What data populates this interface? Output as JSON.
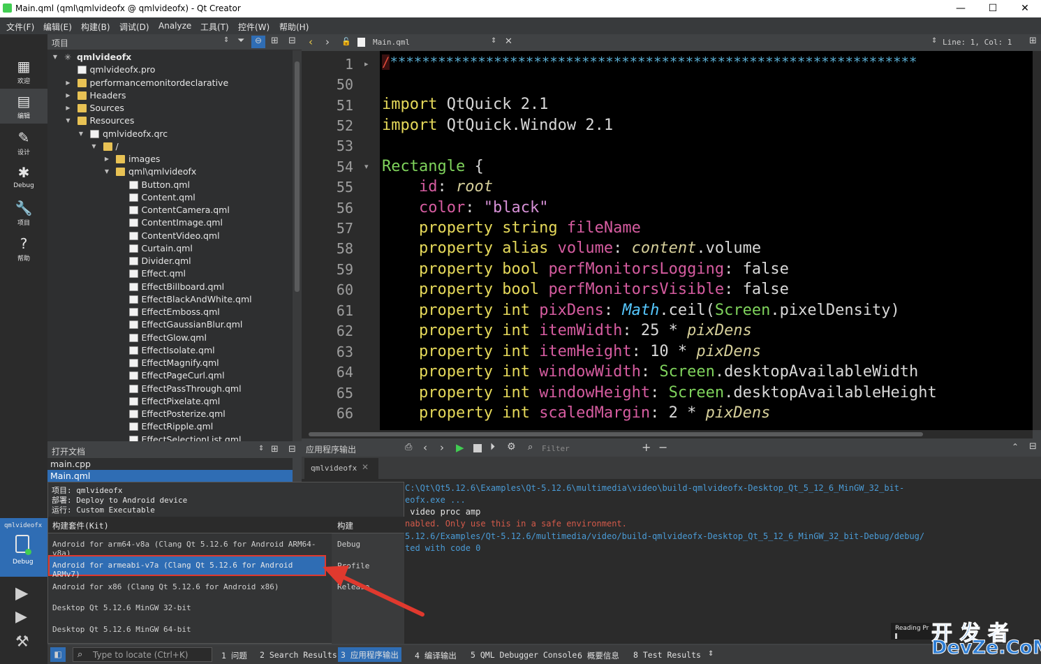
{
  "window": {
    "title": "Main.qml (qml\\qmlvideofx @ qmlvideofx) - Qt Creator",
    "minimize": "—",
    "maximize": "☐",
    "close": "✕"
  },
  "menu": [
    "文件(F)",
    "编辑(E)",
    "构建(B)",
    "调试(D)",
    "Analyze",
    "工具(T)",
    "控件(W)",
    "帮助(H)"
  ],
  "modes": [
    {
      "label": "欢迎",
      "icon": "grid-icon"
    },
    {
      "label": "编辑",
      "icon": "edit-icon"
    },
    {
      "label": "设计",
      "icon": "pen-icon"
    },
    {
      "label": "Debug",
      "icon": "bug-icon"
    },
    {
      "label": "项目",
      "icon": "wrench-icon"
    },
    {
      "label": "帮助",
      "icon": "help-icon"
    }
  ],
  "kit_mode": {
    "project": "qmlvideofx",
    "label": "Debug"
  },
  "project_panel": {
    "title": "项目"
  },
  "tree": [
    {
      "label": "qmlvideofx",
      "depth": 0,
      "arrow": "▼",
      "icon": "project"
    },
    {
      "label": "qmlvideofx.pro",
      "depth": 1,
      "arrow": "",
      "icon": "file"
    },
    {
      "label": "performancemonitordeclarative",
      "depth": 1,
      "arrow": "▶",
      "icon": "folder"
    },
    {
      "label": "Headers",
      "depth": 1,
      "arrow": "▶",
      "icon": "folder"
    },
    {
      "label": "Sources",
      "depth": 1,
      "arrow": "▶",
      "icon": "folder"
    },
    {
      "label": "Resources",
      "depth": 1,
      "arrow": "▼",
      "icon": "folder"
    },
    {
      "label": "qmlvideofx.qrc",
      "depth": 2,
      "arrow": "▼",
      "icon": "file"
    },
    {
      "label": "/",
      "depth": 3,
      "arrow": "▼",
      "icon": "folder"
    },
    {
      "label": "images",
      "depth": 4,
      "arrow": "▶",
      "icon": "folder"
    },
    {
      "label": "qml\\qmlvideofx",
      "depth": 4,
      "arrow": "▼",
      "icon": "folder"
    },
    {
      "label": "Button.qml",
      "depth": 5,
      "arrow": "",
      "icon": "qml"
    },
    {
      "label": "Content.qml",
      "depth": 5,
      "arrow": "",
      "icon": "qml"
    },
    {
      "label": "ContentCamera.qml",
      "depth": 5,
      "arrow": "",
      "icon": "qml"
    },
    {
      "label": "ContentImage.qml",
      "depth": 5,
      "arrow": "",
      "icon": "qml"
    },
    {
      "label": "ContentVideo.qml",
      "depth": 5,
      "arrow": "",
      "icon": "qml"
    },
    {
      "label": "Curtain.qml",
      "depth": 5,
      "arrow": "",
      "icon": "qml"
    },
    {
      "label": "Divider.qml",
      "depth": 5,
      "arrow": "",
      "icon": "qml"
    },
    {
      "label": "Effect.qml",
      "depth": 5,
      "arrow": "",
      "icon": "qml"
    },
    {
      "label": "EffectBillboard.qml",
      "depth": 5,
      "arrow": "",
      "icon": "qml"
    },
    {
      "label": "EffectBlackAndWhite.qml",
      "depth": 5,
      "arrow": "",
      "icon": "qml"
    },
    {
      "label": "EffectEmboss.qml",
      "depth": 5,
      "arrow": "",
      "icon": "qml"
    },
    {
      "label": "EffectGaussianBlur.qml",
      "depth": 5,
      "arrow": "",
      "icon": "qml"
    },
    {
      "label": "EffectGlow.qml",
      "depth": 5,
      "arrow": "",
      "icon": "qml"
    },
    {
      "label": "EffectIsolate.qml",
      "depth": 5,
      "arrow": "",
      "icon": "qml"
    },
    {
      "label": "EffectMagnify.qml",
      "depth": 5,
      "arrow": "",
      "icon": "qml"
    },
    {
      "label": "EffectPageCurl.qml",
      "depth": 5,
      "arrow": "",
      "icon": "qml"
    },
    {
      "label": "EffectPassThrough.qml",
      "depth": 5,
      "arrow": "",
      "icon": "qml"
    },
    {
      "label": "EffectPixelate.qml",
      "depth": 5,
      "arrow": "",
      "icon": "qml"
    },
    {
      "label": "EffectPosterize.qml",
      "depth": 5,
      "arrow": "",
      "icon": "qml"
    },
    {
      "label": "EffectRipple.qml",
      "depth": 5,
      "arrow": "",
      "icon": "qml"
    },
    {
      "label": "EffectSelectionList.qml",
      "depth": 5,
      "arrow": "",
      "icon": "qml"
    }
  ],
  "open_docs": {
    "title": "打开文档",
    "items": [
      "main.cpp",
      "Main.qml"
    ],
    "selected": 1
  },
  "editor": {
    "file": "Main.qml",
    "position": "Line: 1, Col: 1"
  },
  "code_lines": [
    {
      "n": "1",
      "fold": "▸"
    },
    {
      "n": "50",
      "fold": ""
    },
    {
      "n": "51",
      "fold": ""
    },
    {
      "n": "52",
      "fold": ""
    },
    {
      "n": "53",
      "fold": ""
    },
    {
      "n": "54",
      "fold": "▾"
    },
    {
      "n": "55",
      "fold": ""
    },
    {
      "n": "56",
      "fold": ""
    },
    {
      "n": "57",
      "fold": ""
    },
    {
      "n": "58",
      "fold": ""
    },
    {
      "n": "59",
      "fold": ""
    },
    {
      "n": "60",
      "fold": ""
    },
    {
      "n": "61",
      "fold": ""
    },
    {
      "n": "62",
      "fold": ""
    },
    {
      "n": "63",
      "fold": ""
    },
    {
      "n": "64",
      "fold": ""
    },
    {
      "n": "65",
      "fold": ""
    },
    {
      "n": "66",
      "fold": ""
    }
  ],
  "code": {
    "l1_slash": "/",
    "l1_stars": "******************************************************************",
    "l51_kw": "import",
    "l51_rest": " QtQuick 2.1",
    "l52_kw": "import",
    "l52_rest": " QtQuick.Window 2.1",
    "l54_kw": "Rectangle",
    "l54_rest": " {",
    "l55_a": "    id",
    "l55_b": ": ",
    "l55_c": "root",
    "l56_a": "    color",
    "l56_b": ": ",
    "l56_c": "\"black\"",
    "l57_a": "    property",
    "l57_b": " string ",
    "l57_c": "fileName",
    "l58_a": "    property",
    "l58_b": " alias ",
    "l58_c": "volume",
    "l58_d": ": ",
    "l58_e": "content",
    "l58_f": ".volume",
    "l59_a": "    property",
    "l59_b": " bool ",
    "l59_c": "perfMonitorsLogging",
    "l59_d": ": false",
    "l60_a": "    property",
    "l60_b": " bool ",
    "l60_c": "perfMonitorsVisible",
    "l60_d": ": false",
    "l61_a": "    property",
    "l61_b": " int ",
    "l61_c": "pixDens",
    "l61_d": ": ",
    "l61_e": "Math",
    "l61_f": ".ceil(",
    "l61_g": "Screen",
    "l61_h": ".pixelDensity)",
    "l62_a": "    property",
    "l62_b": " int ",
    "l62_c": "itemWidth",
    "l62_d": ": 25 * ",
    "l62_e": "pixDens",
    "l63_a": "    property",
    "l63_b": " int ",
    "l63_c": "itemHeight",
    "l63_d": ": 10 * ",
    "l63_e": "pixDens",
    "l64_a": "    property",
    "l64_b": " int ",
    "l64_c": "windowWidth",
    "l64_d": ": ",
    "l64_e": "Screen",
    "l64_f": ".desktopAvailableWidth",
    "l65_a": "    property",
    "l65_b": " int ",
    "l65_c": "windowHeight",
    "l65_d": ": ",
    "l65_e": "Screen",
    "l65_f": ".desktopAvailableHeight",
    "l66_a": "    property",
    "l66_b": " int ",
    "l66_c": "scaledMargin",
    "l66_d": ": 2 * ",
    "l66_e": "pixDens"
  },
  "output": {
    "title": "应用程序输出",
    "filter_placeholder": "Filter",
    "tab": "qmlvideofx",
    "lines": [
      {
        "text": "C:\\Qt\\Qt5.12.6\\Examples\\Qt-5.12.6\\multimedia\\video\\build-qmlvideofx-Desktop_Qt_5_12_6_MinGW_32_bit-",
        "color": "#4a9bd6"
      },
      {
        "text": "eofx.exe ...",
        "color": "#4a9bd6"
      },
      {
        "text": " video proc amp",
        "color": "#e6e6e6"
      },
      {
        "text": "nabled. Only use this in a safe environment.",
        "color": "#d45a4a"
      },
      {
        "text": "5.12.6/Examples/Qt-5.12.6/multimedia/video/build-qmlvideofx-Desktop_Qt_5_12_6_MinGW_32_bit-Debug/debug/",
        "color": "#4a9bd6"
      },
      {
        "text": "ted with code 0",
        "color": "#4a9bd6"
      }
    ],
    "reading": "Reading Pr"
  },
  "kit_popup": {
    "info": [
      "项目: qmlvideofx",
      "部署: Deploy to Android device",
      "运行: Custom Executable"
    ],
    "kit_header": "构建套件(Kit)",
    "build_header": "构建",
    "kits": [
      "Android for arm64-v8a (Clang Qt 5.12.6 for Android ARM64-v8a)",
      "Android for armeabi-v7a (Clang Qt 5.12.6 for Android ARMv7)",
      "Android for x86 (Clang Qt 5.12.6 for Android x86)",
      "Desktop Qt 5.12.6 MinGW 32-bit",
      "Desktop Qt 5.12.6 MinGW 64-bit"
    ],
    "builds": [
      "Debug",
      "Profile",
      "Release"
    ],
    "highlighted": 1
  },
  "statusbar": {
    "locator_placeholder": "Type to locate (Ctrl+K)",
    "tabs": [
      "1 问题",
      "2 Search Results",
      "3 应用程序输出",
      "4 编译输出",
      "5 QML Debugger Console",
      "6 概要信息",
      "8 Test Results"
    ],
    "active": 2
  },
  "watermark": {
    "line1": "开 发 者",
    "line2": "DevZe.CoM"
  },
  "colors": {
    "accent": "#2f6db4",
    "highlight": "#e0392e",
    "run": "#41cd52"
  }
}
